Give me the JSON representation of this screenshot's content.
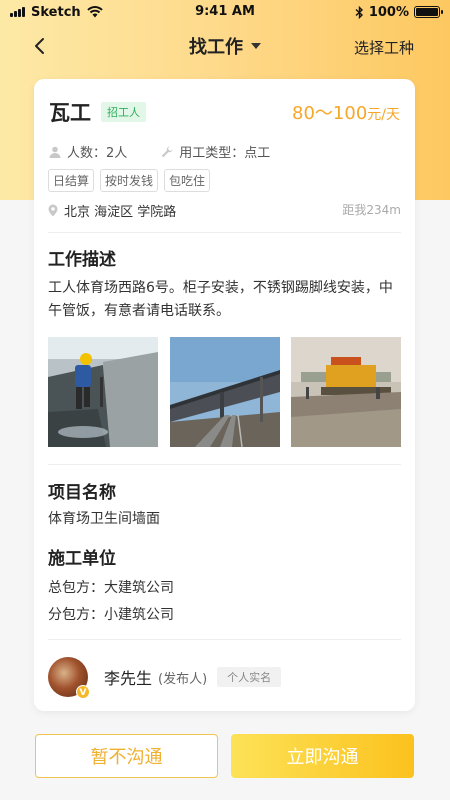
{
  "status_bar": {
    "carrier": "Sketch",
    "time": "9:41 AM",
    "battery": "100%"
  },
  "nav": {
    "title": "找工作",
    "right_action": "选择工种"
  },
  "job": {
    "title": "瓦工",
    "badge": "招工人",
    "salary": "80～100",
    "salary_unit": "元/天",
    "headcount": "人数：2人",
    "work_type": "用工类型：点工",
    "tags": [
      "日结算",
      "按时发钱",
      "包吃住"
    ],
    "location": "北京 海淀区 学院路",
    "distance": "距我234m"
  },
  "description": {
    "heading": "工作描述",
    "text": "工人体育场西路6号。柜子安装，不锈钢踢脚线安装，中午管饭，有意者请电话联系。"
  },
  "project": {
    "heading": "项目名称",
    "name": "体育场卫生间墙面"
  },
  "contractor": {
    "heading": "施工单位",
    "general": "总包方：大建筑公司",
    "sub": "分包方：小建筑公司"
  },
  "publisher": {
    "name": "李先生",
    "role": "(发布人)",
    "verify": "个人实名",
    "badge": "V"
  },
  "actions": {
    "later": "暂不沟通",
    "now": "立即沟通"
  },
  "colors": {
    "accent": "#f6a72a",
    "recruit_badge": "#2eae5c",
    "button_gradient_start": "#fde257",
    "button_gradient_end": "#fbc21e"
  }
}
